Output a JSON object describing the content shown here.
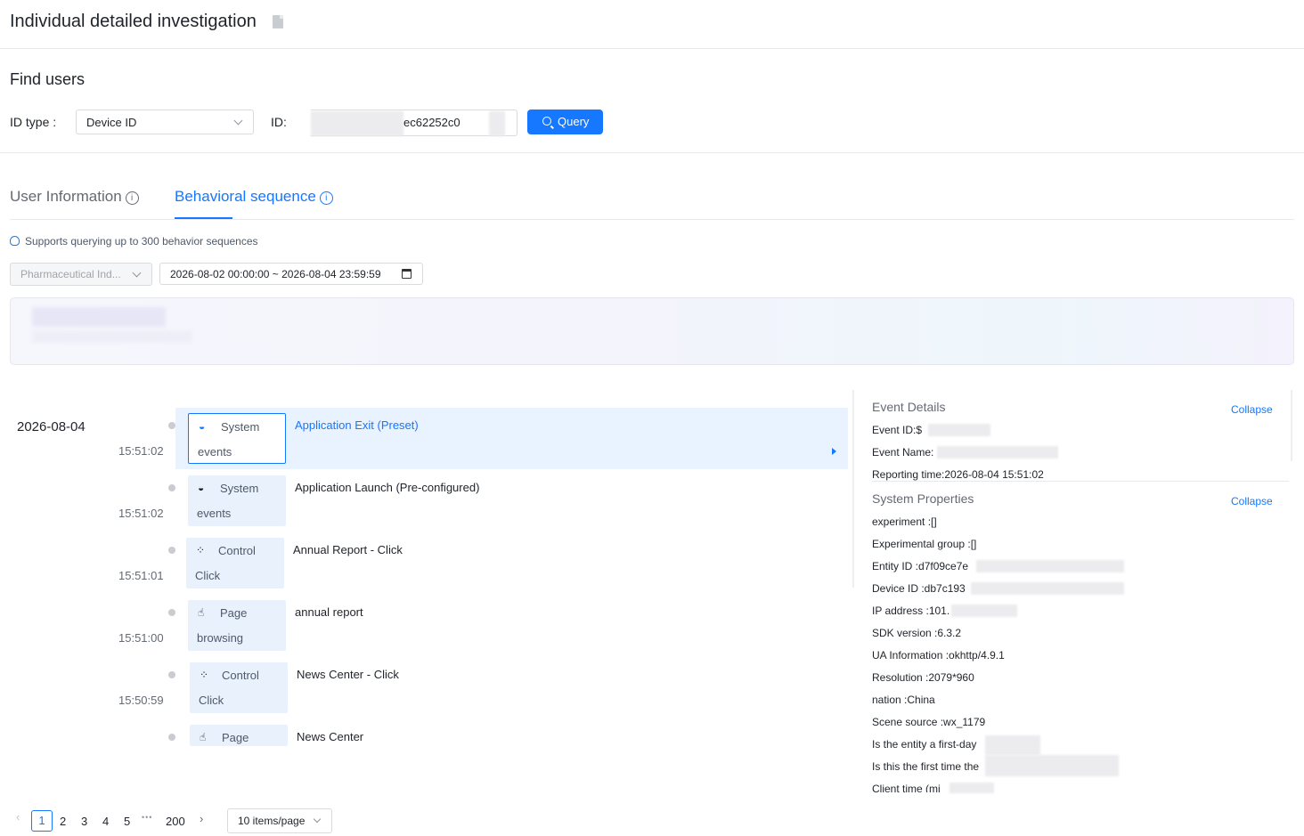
{
  "header": {
    "title": "Individual detailed investigation",
    "doc_icon": "document-icon"
  },
  "find_users": {
    "title": "Find users",
    "id_type_label": "ID type :",
    "id_type_value": "Device ID",
    "id_label": "ID:",
    "id_value": "ec62252c0",
    "query_label": "Query"
  },
  "tabs": [
    {
      "label": "User Information",
      "active": false
    },
    {
      "label": "Behavioral sequence",
      "active": true
    }
  ],
  "info_glyph": "i",
  "hint": "Supports querying up to 300 behavior sequences",
  "filters": {
    "project": "Pharmaceutical Ind...",
    "date_range": "2026-08-02 00:00:00 ~ 2026-08-04 23:59:59"
  },
  "timeline": {
    "date": "2026-08-04",
    "events": [
      {
        "time": "15:51:02",
        "icon": "◒",
        "type_line1": "System",
        "type_line2": "events",
        "name": "Application Exit (Preset)",
        "active": true
      },
      {
        "time": "15:51:02",
        "icon": "◒",
        "type_line1": "System",
        "type_line2": "events",
        "name": "Application Launch (Pre-configured)",
        "active": false
      },
      {
        "time": "15:51:01",
        "icon": "⁘",
        "type_line1": "Control",
        "type_line2": "Click",
        "name": "Annual Report - Click",
        "active": false
      },
      {
        "time": "15:51:00",
        "icon": "☝",
        "type_line1": "Page",
        "type_line2": "browsing",
        "name": "annual report",
        "active": false
      },
      {
        "time": "15:50:59",
        "icon": "⁘",
        "type_line1": "Control",
        "type_line2": "Click",
        "name": "News Center - Click",
        "active": false
      },
      {
        "time": "",
        "icon": "☝",
        "type_line1": "Page",
        "type_line2": "",
        "name": "News Center",
        "active": false
      }
    ]
  },
  "event_details": {
    "title": "Event Details",
    "collapse": "Collapse",
    "rows": [
      "Event ID:$",
      "Event Name:",
      "Reporting time:2026-08-04 15:51:02"
    ]
  },
  "system_properties": {
    "title": "System Properties",
    "collapse": "Collapse",
    "rows": [
      "experiment :[]",
      "Experimental group :[]",
      "Entity ID :d7f09ce7e",
      "Device ID :db7c193",
      "IP address :101.",
      "SDK version :6.3.2",
      "UA Information :okhttp/4.9.1",
      "Resolution :2079*960",
      "nation :China",
      "Scene source :wx_1179",
      "Is the entity a first-day",
      "Is this the first time the",
      "Client time (mi"
    ]
  },
  "pagination": {
    "prev": "‹",
    "next": "›",
    "current": "1",
    "pages": [
      "2",
      "3",
      "4",
      "5"
    ],
    "ellipsis": "•••",
    "last": "200",
    "page_size": "10 items/page"
  }
}
